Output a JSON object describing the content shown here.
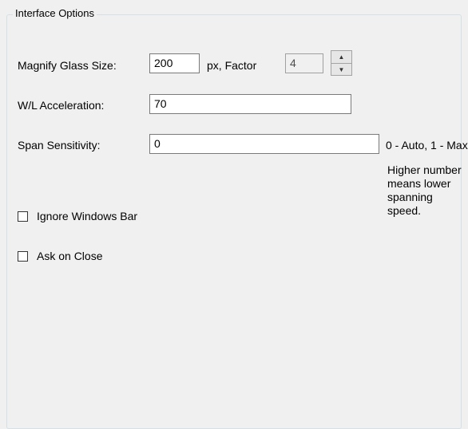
{
  "group": {
    "title": "Interface Options"
  },
  "magnify": {
    "label": "Magnify Glass Size:",
    "value": "200",
    "unit_label": "px, Factor",
    "factor_value": "4",
    "spin_up_icon": "▲",
    "spin_down_icon": "▼"
  },
  "wl_acceleration": {
    "label": "W/L Acceleration:",
    "value": "70"
  },
  "span_sensitivity": {
    "label": "Span Sensitivity:",
    "value": "0",
    "range_note": "0 - Auto, 1 - Max",
    "hint": "Higher number means lower spanning speed."
  },
  "options": {
    "ignore_windows_bar": {
      "label": "Ignore Windows Bar",
      "checked": false
    },
    "ask_on_close": {
      "label": "Ask on Close",
      "checked": false
    }
  }
}
